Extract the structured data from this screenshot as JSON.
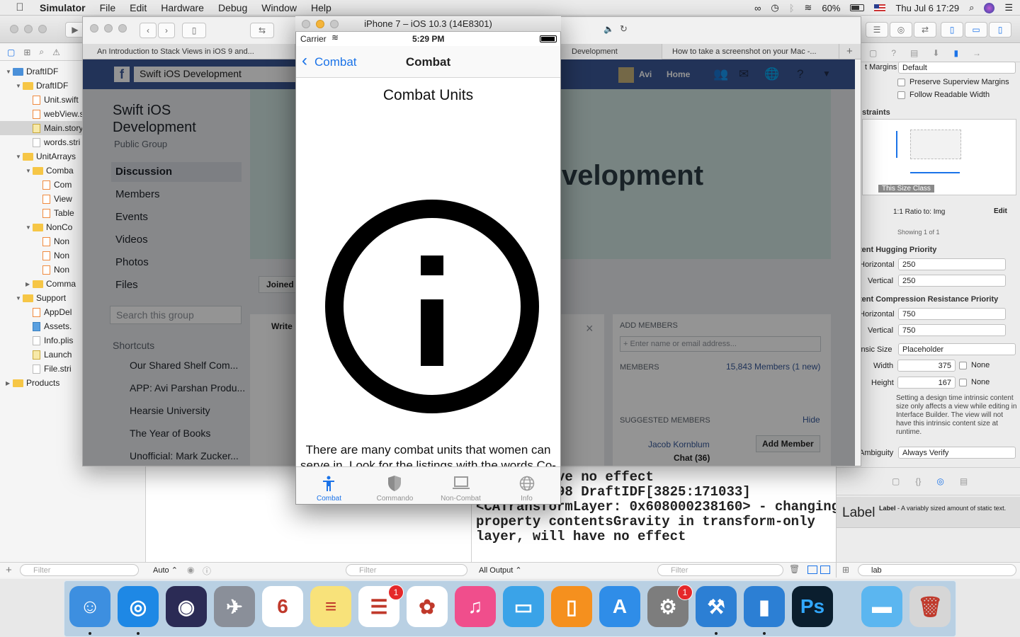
{
  "menubar": {
    "app": "Simulator",
    "items": [
      "File",
      "Edit",
      "Hardware",
      "Debug",
      "Window",
      "Help"
    ],
    "battery": "60%",
    "clock": "Thu Jul 6  17:29"
  },
  "navigator": {
    "rows": [
      {
        "label": "DraftIDF",
        "kind": "project",
        "indent": 0,
        "open": true
      },
      {
        "label": "DraftIDF",
        "kind": "folder",
        "indent": 1,
        "open": true
      },
      {
        "label": "Unit.swift",
        "kind": "swift",
        "indent": 2
      },
      {
        "label": "webView.s",
        "kind": "swift",
        "indent": 2
      },
      {
        "label": "Main.story",
        "kind": "storyboard",
        "indent": 2,
        "selected": true
      },
      {
        "label": "words.stri",
        "kind": "file",
        "indent": 2
      },
      {
        "label": "UnitArrays",
        "kind": "folder",
        "indent": 1,
        "open": true
      },
      {
        "label": "Comba",
        "kind": "folder",
        "indent": 2,
        "open": true
      },
      {
        "label": "Com",
        "kind": "swift",
        "indent": 3
      },
      {
        "label": "View",
        "kind": "swift",
        "indent": 3
      },
      {
        "label": "Table",
        "kind": "swift",
        "indent": 3
      },
      {
        "label": "NonCo",
        "kind": "folder",
        "indent": 2,
        "open": true
      },
      {
        "label": "Non",
        "kind": "swift",
        "indent": 3
      },
      {
        "label": "Non",
        "kind": "swift",
        "indent": 3
      },
      {
        "label": "Non",
        "kind": "swift",
        "indent": 3
      },
      {
        "label": "Comma",
        "kind": "folder",
        "indent": 2,
        "open": false
      },
      {
        "label": "Support",
        "kind": "folder",
        "indent": 1,
        "open": true
      },
      {
        "label": "AppDel",
        "kind": "swift",
        "indent": 2
      },
      {
        "label": "Assets.",
        "kind": "assets",
        "indent": 2
      },
      {
        "label": "Info.plis",
        "kind": "file",
        "indent": 2
      },
      {
        "label": "Launch",
        "kind": "storyboard",
        "indent": 2
      },
      {
        "label": "File.stri",
        "kind": "file",
        "indent": 2
      },
      {
        "label": "Products",
        "kind": "folder",
        "indent": 0,
        "open": false
      }
    ],
    "filter_placeholder": "Filter"
  },
  "debug": {
    "auto_label": "Auto",
    "filter_placeholder": "Filter",
    "all_output": "All Output",
    "console_lines": [
      "        have no effect",
      "17:24:09.198 DraftIDF[3825:171033]",
      "<CATransformLayer: 0x608000238160> - changing",
      "property contentsGravity in transform-only",
      "layer, will have no effect"
    ]
  },
  "safari": {
    "tabs": [
      "An Introduction to Stack Views in iOS 9 and...",
      "Development",
      "How to take a screenshot on your Mac -..."
    ],
    "fb_search": "Swift iOS Development",
    "fb_user": "Avi",
    "fb_home": "Home",
    "group_title": "Swift iOS Development",
    "group_type": "Public Group",
    "side_links": [
      "Discussion",
      "Members",
      "Events",
      "Videos",
      "Photos",
      "Files"
    ],
    "search_group": "Search this group",
    "shortcuts_title": "Shortcuts",
    "shortcuts": [
      "Our Shared Shelf Com...",
      "APP: Avi Parshan Produ...",
      "Hearsie University",
      "The Year of Books",
      "Unofficial: Mark Zucker..."
    ],
    "banner_text": "velopment",
    "joined": "Joined",
    "write": "Write",
    "add_members_title": "ADD MEMBERS",
    "add_members_placeholder": "+ Enter name or email address...",
    "members_title": "MEMBERS",
    "members_count": "15,843 Members (1 new)",
    "suggested_title": "SUGGESTED MEMBERS",
    "hide": "Hide",
    "suggested_name": "Jacob Kornblum",
    "add_member": "Add Member",
    "chat": "Chat (36)"
  },
  "inspector": {
    "margins_label": "t Margins",
    "margins_value": "Default",
    "preserve": "Preserve Superview Margins",
    "readable": "Follow Readable Width",
    "constraints_title": "straints",
    "size_class": "This Size Class",
    "ratio": "1:1 Ratio to:  Img",
    "edit": "Edit",
    "showing": "Showing 1 of 1",
    "hugging_title": "tent Hugging Priority",
    "horizontal_label": "Horizontal",
    "vertical_label": "Vertical",
    "hug_h": "250",
    "hug_v": "250",
    "compression_title": "tent Compression Resistance Priority",
    "comp_h": "750",
    "comp_v": "750",
    "intrinsic_label": "insic Size",
    "intrinsic_value": "Placeholder",
    "width_label": "Width",
    "width_value": "375",
    "height_label": "Height",
    "height_value": "167",
    "none": "None",
    "note": "Setting a design time intrinsic content size only affects a view while editing in Interface Builder. The view will not have this intrinsic content size at runtime.",
    "ambiguity_label": "Ambiguity",
    "ambiguity_value": "Always Verify",
    "library_item_big": "Label",
    "library_item_title": "Label",
    "library_item_desc": " - A variably sized amount of static text.",
    "library_filter": "lab"
  },
  "simulator": {
    "title": "iPhone 7 – iOS 10.3 (14E8301)",
    "carrier": "Carrier",
    "time": "5:29 PM",
    "back_label": "Combat",
    "nav_title": "Combat",
    "heading": "Combat Units",
    "body": "There are many combat units that women can serve in. Look for the listings with the words Co-",
    "tabs": [
      {
        "label": "Combat",
        "icon": "person-icon",
        "selected": true
      },
      {
        "label": "Commando",
        "icon": "shield-icon",
        "selected": false
      },
      {
        "label": "Non-Combat",
        "icon": "laptop-icon",
        "selected": false
      },
      {
        "label": "Info",
        "icon": "globe-icon",
        "selected": false
      }
    ]
  },
  "dock": {
    "apps": [
      {
        "name": "Finder",
        "color": "#3d8fe0",
        "glyph": "☺"
      },
      {
        "name": "Safari",
        "color": "#1e88e5",
        "glyph": "◎"
      },
      {
        "name": "Siri",
        "color": "#2b2b55",
        "glyph": "◉"
      },
      {
        "name": "Launchpad",
        "color": "#8a8f99",
        "glyph": "✈"
      },
      {
        "name": "Calendar",
        "color": "#ffffff",
        "glyph": "6",
        "sub": "JUL"
      },
      {
        "name": "Notes",
        "color": "#f8e27a",
        "glyph": "≡"
      },
      {
        "name": "Reminders",
        "color": "#ffffff",
        "glyph": "☰",
        "badge": "1"
      },
      {
        "name": "Photos",
        "color": "#ffffff",
        "glyph": "✿"
      },
      {
        "name": "iTunes",
        "color": "#f04e8c",
        "glyph": "♫"
      },
      {
        "name": "Keynote",
        "color": "#3aa3e8",
        "glyph": "▭"
      },
      {
        "name": "iBooks",
        "color": "#f5901e",
        "glyph": "▯"
      },
      {
        "name": "App Store",
        "color": "#2f8de8",
        "glyph": "A"
      },
      {
        "name": "System Preferences",
        "color": "#7d7d7d",
        "glyph": "⚙",
        "badge": "1"
      },
      {
        "name": "Xcode",
        "color": "#2c7fd4",
        "glyph": "⚒"
      },
      {
        "name": "Simulator",
        "color": "#2c7fd4",
        "glyph": "▮"
      },
      {
        "name": "Photoshop",
        "color": "#0a1e2e",
        "glyph": "Ps"
      },
      {
        "name": "Downloads",
        "color": "#5bb6f0",
        "glyph": "▬"
      },
      {
        "name": "Trash",
        "color": "#d6d6d6",
        "glyph": "🗑"
      }
    ]
  },
  "colors": {
    "tint": "#1b73e8",
    "facebook": "#3b5998"
  }
}
